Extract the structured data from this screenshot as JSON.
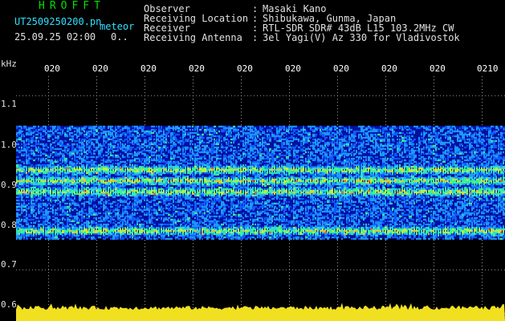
{
  "header": {
    "app_name": "HROFFT",
    "filename": "UT2509250200.pn",
    "mode": "meteor",
    "datetime": "25.09.25 02:00",
    "count": "0..",
    "fields": [
      {
        "label": "Observer",
        "sep": ":",
        "value": "Masaki Kano"
      },
      {
        "label": "Receiving Location",
        "sep": ":",
        "value": "Shibukawa, Gunma, Japan"
      },
      {
        "label": "Receiver",
        "sep": ":",
        "value": "RTL-SDR SDR# 43dB L15 103.2MHz CW"
      },
      {
        "label": "Receiving Antenna",
        "sep": ":",
        "value": "3el Yagi(V) Az 330 for Vladivostok"
      }
    ]
  },
  "plot": {
    "y_unit": "kHz",
    "y_ticks": [
      "1.1",
      "1.0",
      "0.9",
      "0.8",
      "0.7",
      "0.6"
    ],
    "x_ticks": [
      "020",
      "020",
      "020",
      "020",
      "020",
      "020",
      "020",
      "020",
      "020",
      "0210"
    ],
    "colors": {
      "background": "#000000",
      "noise": "#0818c8",
      "floor": "#f0e020",
      "grid": "#9a9a9a"
    }
  },
  "chart_data": {
    "type": "heatmap",
    "y_unit": "kHz",
    "ylim": [
      0.6,
      1.14
    ],
    "signal_band": [
      0.77,
      1.03
    ],
    "strong_lines_khz": [
      0.93,
      0.905,
      0.88,
      0.79
    ],
    "x_tick_labels": [
      "020",
      "020",
      "020",
      "020",
      "020",
      "020",
      "020",
      "020",
      "020",
      "0210"
    ]
  }
}
